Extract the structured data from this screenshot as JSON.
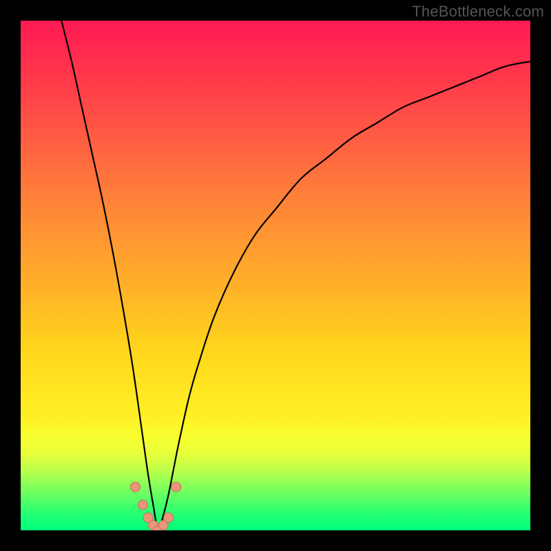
{
  "attribution": "TheBottleneck.com",
  "colors": {
    "page_bg": "#000000",
    "gradient_top": "#ff1a52",
    "gradient_mid": "#ffd41b",
    "gradient_bottom": "#00ff7e",
    "curve_stroke": "#000000",
    "marker_fill": "#e9967a",
    "marker_stroke": "#cc6b5a"
  },
  "chart_data": {
    "type": "line",
    "title": "",
    "xlabel": "",
    "ylabel": "",
    "xlim": [
      0,
      100
    ],
    "ylim": [
      0,
      100
    ],
    "grid": false,
    "legend": false,
    "description": "V-shaped bottleneck curve. Y is mismatch severity (0 = perfect green bottom, 100 = severe red top). Minimum sits near x≈27.",
    "series": [
      {
        "name": "bottleneck-curve",
        "x": [
          8,
          10,
          12,
          14,
          16,
          18,
          20,
          22,
          24,
          25,
          26,
          27,
          28,
          29,
          30,
          31,
          33,
          35,
          38,
          42,
          46,
          50,
          55,
          60,
          65,
          70,
          75,
          80,
          85,
          90,
          95,
          100
        ],
        "values": [
          100,
          92,
          83,
          74,
          65,
          55,
          44,
          32,
          18,
          11,
          5,
          0,
          3,
          7,
          12,
          17,
          26,
          33,
          42,
          51,
          58,
          63,
          69,
          73,
          77,
          80,
          83,
          85,
          87,
          89,
          91,
          92
        ]
      }
    ],
    "markers": {
      "name": "valley-markers",
      "x": [
        22.5,
        24.0,
        25.0,
        26.0,
        27.0,
        28.0,
        29.0,
        30.5
      ],
      "values": [
        8.5,
        5.0,
        2.5,
        1.0,
        0.0,
        1.0,
        2.5,
        8.5
      ]
    }
  }
}
